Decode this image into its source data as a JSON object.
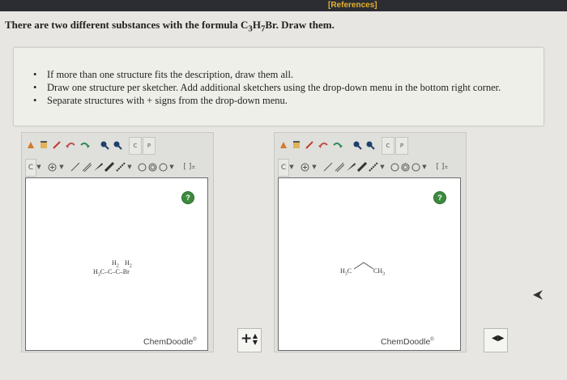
{
  "header": {
    "references": "[References]"
  },
  "question": {
    "pre": "There are two different substances with the formula C",
    "c_sub": "3",
    "h": "H",
    "h_sub": "7",
    "post": "Br. Draw them."
  },
  "instructions": [
    "If more than one structure fits the description, draw them all.",
    "Draw one structure per sketcher. Add additional sketchers using the drop-down menu in the bottom right corner.",
    "Separate structures with + signs from the drop-down menu."
  ],
  "sketchers": [
    {
      "brand": "ChemDoodle",
      "help": "?",
      "molecule": {
        "top_h": "H",
        "top_sub": "2",
        "line": "H",
        "line_sub": "3",
        "chain": "C–C–C–Br"
      },
      "toolbar": {
        "carbon": "C",
        "ring_label": "[ ]",
        "ring_sup": "±",
        "tool_c": "C",
        "tool_p": "P"
      }
    },
    {
      "brand": "ChemDoodle",
      "help": "?",
      "molecule": {
        "left": "H",
        "left_sub": "3",
        "left_c": "C",
        "right": "CH",
        "right_sub": "3"
      },
      "toolbar": {
        "carbon": "C",
        "ring_label": "[ ]",
        "ring_sup": "±",
        "tool_c": "C",
        "tool_p": "P"
      }
    }
  ],
  "add_controls": [
    {
      "symbol": "+"
    },
    {
      "symbol": ""
    }
  ],
  "colors": {
    "topbar": "#2b2d33",
    "references": "#e9b12e",
    "help": "#3d8a3f"
  }
}
